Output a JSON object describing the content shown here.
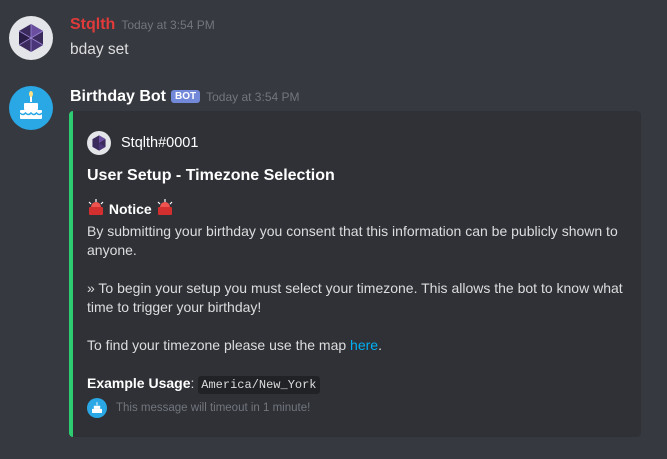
{
  "message1": {
    "username": "Stqlth",
    "timestamp": "Today at 3:54 PM",
    "content": "bday set"
  },
  "message2": {
    "username": "Birthday Bot",
    "badge": "BOT",
    "timestamp": "Today at 3:54 PM",
    "embed": {
      "accent_color": "#2ecc71",
      "author": "Stqlth#0001",
      "title": "User Setup - Timezone Selection",
      "notice_label": "Notice",
      "notice_text": "By submitting your birthday you consent that this information can be publicly shown to anyone.",
      "setup_text": "» To begin your setup you must select your timezone. This allows the bot to know what time to trigger your birthday!",
      "map_text": "To find your timezone please use the map ",
      "map_link": "here",
      "map_suffix": ".",
      "example_label": "Example Usage",
      "example_sep": ": ",
      "example_code": "America/New_York",
      "footer": "This message will timeout in 1 minute!"
    }
  },
  "icons": {
    "user_avatar": "polyhedron-avatar-icon",
    "bot_avatar": "birthday-cake-icon",
    "notice": "police-light-icon"
  }
}
